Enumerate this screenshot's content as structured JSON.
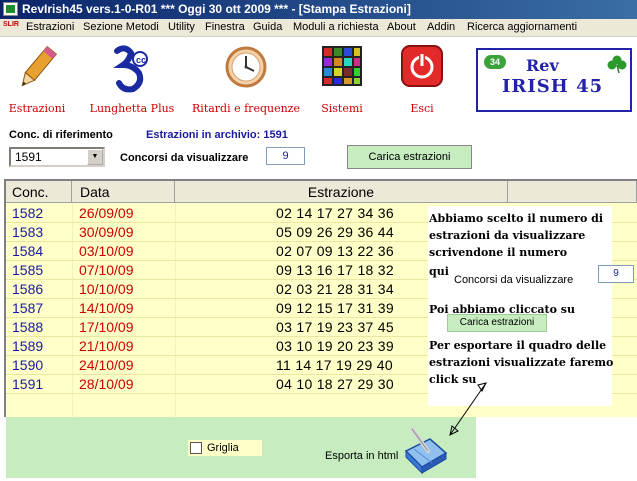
{
  "window": {
    "title": "RevIrish45 vers.1-0-R01  ***  Oggi 30 ott 2009  ***   - [Stampa Estrazioni]",
    "logo_text": "SLIR"
  },
  "menu": [
    {
      "label": "Estrazioni"
    },
    {
      "label": "Sezione Metodi"
    },
    {
      "label": "Utility"
    },
    {
      "label": "Finestra"
    },
    {
      "label": "Guida"
    },
    {
      "label": "Moduli a richiesta"
    },
    {
      "label": "About"
    },
    {
      "label": "Addin"
    },
    {
      "label": "Ricerca aggiornamenti"
    }
  ],
  "toolbar": {
    "estrazioni": "Estrazioni",
    "lunghetta": "Lunghetta Plus",
    "ritardi": "Ritardi e frequenze",
    "sistemi": "Sistemi",
    "esci": "Esci"
  },
  "brand": {
    "badge": "34",
    "line1": "Rev",
    "line2": "IRISH 45"
  },
  "controls": {
    "conc_label": "Conc. di riferimento",
    "archive_label": "Estrazioni in archivio: 1591",
    "conc_value": "1591",
    "view_label": "Concorsi da visualizzare",
    "view_value": "9",
    "load_button": "Carica estrazioni"
  },
  "table": {
    "headers": [
      "Conc.",
      "Data",
      "Estrazione"
    ],
    "rows": [
      {
        "conc": "1582",
        "data": "26/09/09",
        "estr": "02 14 17 27 34 36"
      },
      {
        "conc": "1583",
        "data": "30/09/09",
        "estr": "05 09 26 29 36 44"
      },
      {
        "conc": "1584",
        "data": "03/10/09",
        "estr": "02 07 09 13 22 36"
      },
      {
        "conc": "1585",
        "data": "07/10/09",
        "estr": "09 13 16 17 18 32"
      },
      {
        "conc": "1586",
        "data": "10/10/09",
        "estr": "02 03 21 28 31 34"
      },
      {
        "conc": "1587",
        "data": "14/10/09",
        "estr": "09 12 15 17 31 39"
      },
      {
        "conc": "1588",
        "data": "17/10/09",
        "estr": "03 17 19 23 37 45"
      },
      {
        "conc": "1589",
        "data": "21/10/09",
        "estr": "03 10 19 20 23 39"
      },
      {
        "conc": "1590",
        "data": "24/10/09",
        "estr": "11 14 17 19 29 40"
      },
      {
        "conc": "1591",
        "data": "28/10/09",
        "estr": "04 10 18 27 29 30"
      }
    ]
  },
  "note": {
    "l1": "Abbiamo scelto il numero di",
    "l2": "estrazioni da visualizzare",
    "l3": "scrivendone il numero",
    "l4": "qui",
    "mini_label": "Concorsi da visualizzare",
    "mini_value": "9",
    "l5": "Poi abbiamo cliccato su",
    "mini_button": "Carica estrazioni",
    "l6": "Per esportare il quadro delle",
    "l7": "estrazioni visualizzate faremo",
    "l8": "click su"
  },
  "bottom": {
    "griglia": "Griglia",
    "export_label": "Esporta in html"
  }
}
